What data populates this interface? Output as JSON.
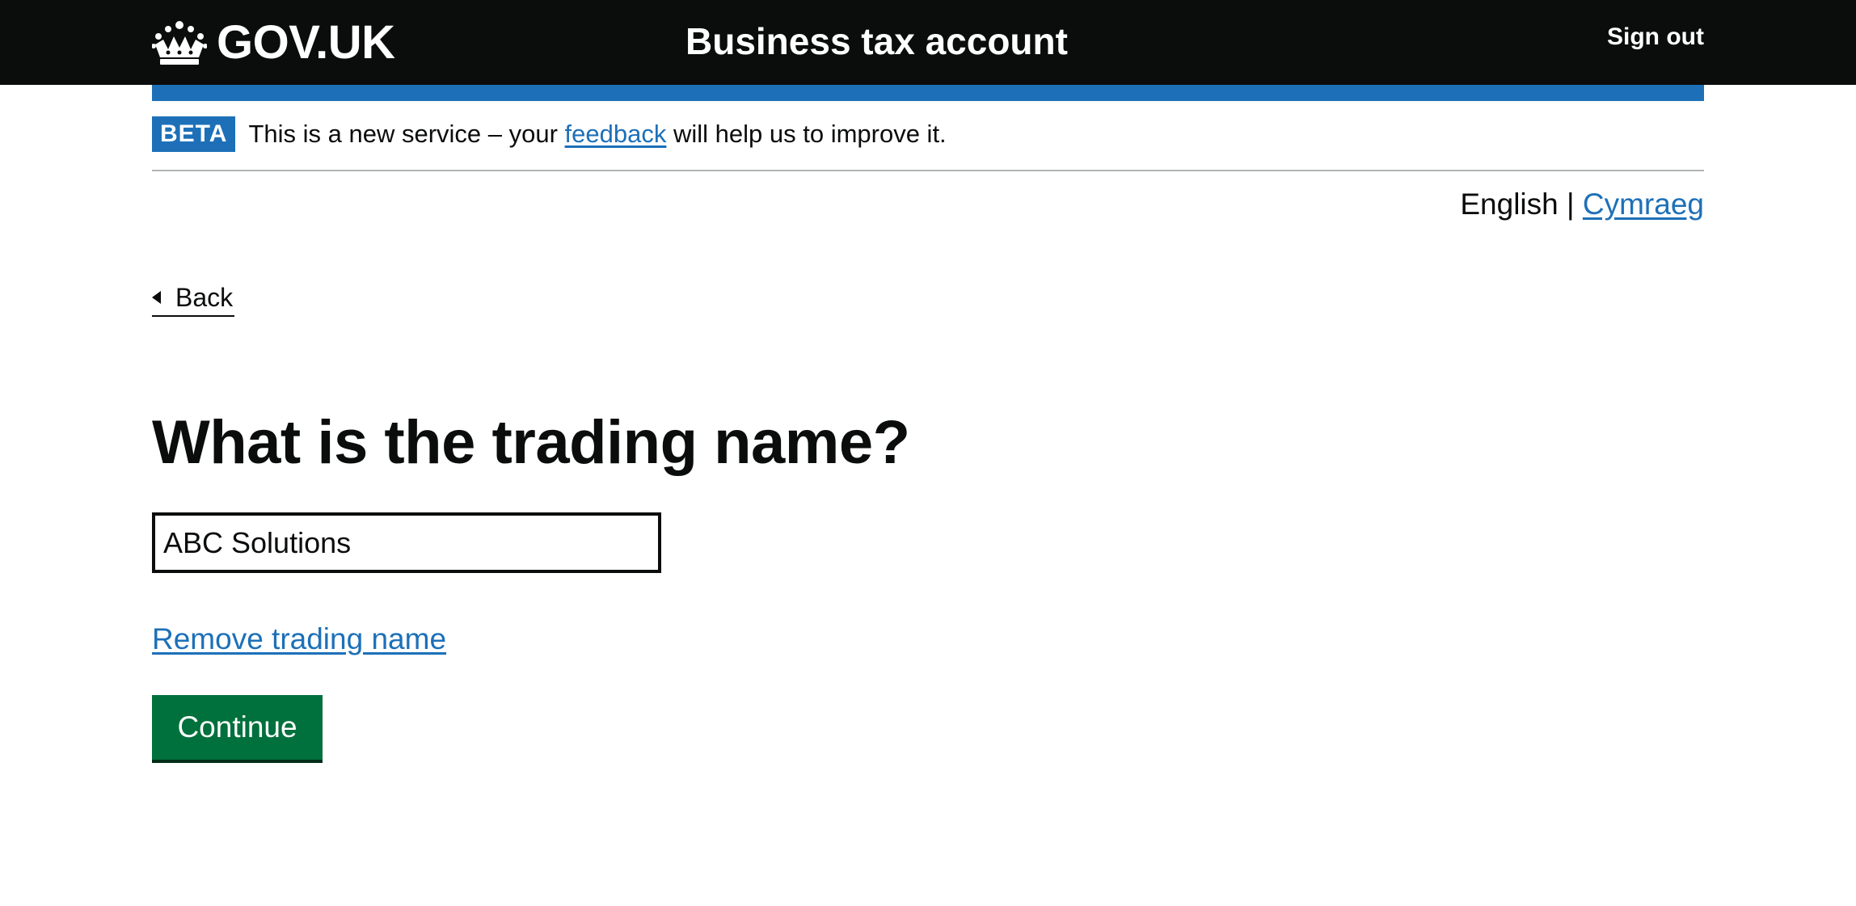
{
  "header": {
    "logo_text": "GOV.UK",
    "service_name": "Business tax account",
    "sign_out_label": "Sign out"
  },
  "phase_banner": {
    "tag": "BETA",
    "text_before": "This is a new service – your ",
    "feedback_link": "feedback",
    "text_after": " will help us to improve it."
  },
  "language": {
    "current": "English",
    "separator": " | ",
    "alternate": "Cymraeg"
  },
  "back_link": "Back",
  "main": {
    "title": "What is the trading name?",
    "input_value": "ABC Solutions",
    "remove_link": "Remove trading name",
    "continue_label": "Continue"
  },
  "colors": {
    "header_bg": "#0b0c0c",
    "brand_blue": "#1d70b8",
    "button_green": "#00703c"
  }
}
